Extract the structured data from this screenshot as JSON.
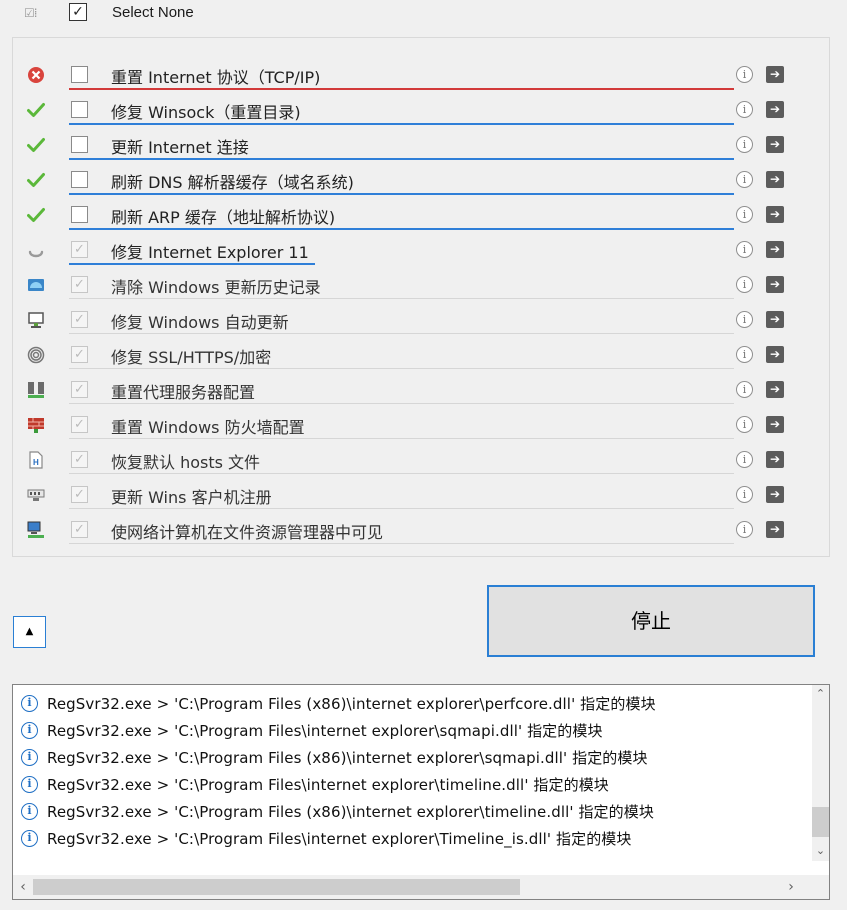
{
  "toolbar": {
    "icon": "select-toggle-icon",
    "select_none_label": "Select None"
  },
  "tasks": [
    {
      "label": "重置 Internet 协议（TCP/IP)",
      "status": "error",
      "icon": "error-icon",
      "checked": false,
      "line_color": "#d23a3a",
      "progress": 1.0
    },
    {
      "label": "修复 Winsock（重置目录)",
      "status": "done",
      "icon": "checkmark-icon",
      "checked": false,
      "line_color": "#2f7fd8",
      "progress": 1.0
    },
    {
      "label": "更新 Internet 连接",
      "status": "done",
      "icon": "checkmark-icon",
      "checked": false,
      "line_color": "#2f7fd8",
      "progress": 1.0
    },
    {
      "label": "刷新 DNS 解析器缓存（域名系统)",
      "status": "done",
      "icon": "checkmark-icon",
      "checked": false,
      "line_color": "#2f7fd8",
      "progress": 1.0
    },
    {
      "label": "刷新 ARP 缓存（地址解析协议)",
      "status": "done",
      "icon": "checkmark-icon",
      "checked": false,
      "line_color": "#2f7fd8",
      "progress": 1.0
    },
    {
      "label": "修复 Internet Explorer 11",
      "status": "running",
      "icon": "spinner-icon",
      "checked": true,
      "line_color": "#2f7fd8",
      "progress": 0.37
    },
    {
      "label": "清除 Windows 更新历史记录",
      "status": "pending",
      "icon": "windows-update-icon",
      "checked": true,
      "line_color": "",
      "progress": 0
    },
    {
      "label": "修复 Windows 自动更新",
      "status": "pending",
      "icon": "monitor-icon",
      "checked": true,
      "line_color": "",
      "progress": 0
    },
    {
      "label": "修复 SSL/HTTPS/加密",
      "status": "pending",
      "icon": "fingerprint-icon",
      "checked": true,
      "line_color": "",
      "progress": 0
    },
    {
      "label": "重置代理服务器配置",
      "status": "pending",
      "icon": "proxy-server-icon",
      "checked": true,
      "line_color": "",
      "progress": 0
    },
    {
      "label": "重置 Windows 防火墙配置",
      "status": "pending",
      "icon": "firewall-icon",
      "checked": true,
      "line_color": "",
      "progress": 0
    },
    {
      "label": "恢复默认 hosts 文件",
      "status": "pending",
      "icon": "hosts-file-icon",
      "checked": true,
      "line_color": "",
      "progress": 0
    },
    {
      "label": "更新 Wins 客户机注册",
      "status": "pending",
      "icon": "network-card-icon",
      "checked": true,
      "line_color": "",
      "progress": 0
    },
    {
      "label": "使网络计算机在文件资源管理器中可见",
      "status": "pending",
      "icon": "network-computer-icon",
      "checked": true,
      "line_color": "",
      "progress": 0
    }
  ],
  "row_buttons": {
    "info_icon": "info-icon",
    "run_icon": "arrow-right-icon"
  },
  "controls": {
    "collapse_icon": "caret-up-icon",
    "stop_label": "停止"
  },
  "log": {
    "icon": "info-icon",
    "lines": [
      "RegSvr32.exe > 'C:\\Program Files (x86)\\internet explorer\\perfcore.dll' 指定的模块",
      "RegSvr32.exe > 'C:\\Program Files\\internet explorer\\sqmapi.dll' 指定的模块",
      "RegSvr32.exe > 'C:\\Program Files (x86)\\internet explorer\\sqmapi.dll' 指定的模块",
      "RegSvr32.exe > 'C:\\Program Files\\internet explorer\\timeline.dll' 指定的模块",
      "RegSvr32.exe > 'C:\\Program Files (x86)\\internet explorer\\timeline.dll' 指定的模块",
      "RegSvr32.exe > 'C:\\Program Files\\internet explorer\\Timeline_is.dll' 指定的模块"
    ]
  }
}
